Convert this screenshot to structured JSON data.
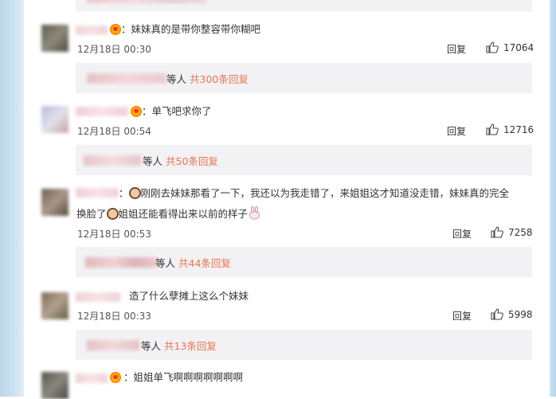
{
  "comments": [
    {
      "text": "：妹妹真的是带你整容带你糊吧",
      "time": "12月18日 00:30",
      "reply": "回复",
      "likes": "17064",
      "sub_suffix": "等人",
      "sub_count": "共300条回复",
      "avatar_color": "#6c6a5c",
      "vip": true
    },
    {
      "text": "：单飞吧求你了",
      "time": "12月18日 00:54",
      "reply": "回复",
      "likes": "12716",
      "sub_suffix": "等人",
      "sub_count": "共50条回复",
      "avatar_color": "#c4c8dc",
      "vip": true
    },
    {
      "text_part1": "：",
      "text_part2": "刚刚去妹妹那看了一下，我还以为我走错了，来姐姐这才知道没走错，妹妹真的完全",
      "text_line2_part1": "换脸了",
      "text_line2_part2": "姐姐还能看得出来以前的样子",
      "time": "12月18日 00:53",
      "reply": "回复",
      "likes": "7258",
      "sub_suffix": "等人",
      "sub_count": "共44条回复",
      "avatar_color": "#7e6f62",
      "vip": false
    },
    {
      "text": "造了什么孽摊上这么个妹妹",
      "time": "12月18日 00:33",
      "reply": "回复",
      "likes": "5998",
      "sub_suffix": "等人",
      "sub_count": "共13条回复",
      "avatar_color": "#8a7a66",
      "vip": false
    },
    {
      "text": "：姐姐单飞啊啊啊啊啊啊啊",
      "avatar_color": "#5f5e58",
      "vip": true
    }
  ],
  "icons": {
    "like": "thumbs-up-icon",
    "vip": "vip-crown-icon",
    "emoji_hand": "emoji-face-palm-icon",
    "emoji_rabbit": "emoji-rabbit-icon"
  },
  "colors": {
    "accent": "#eb7350",
    "reply_bg": "#f2f2f5"
  }
}
